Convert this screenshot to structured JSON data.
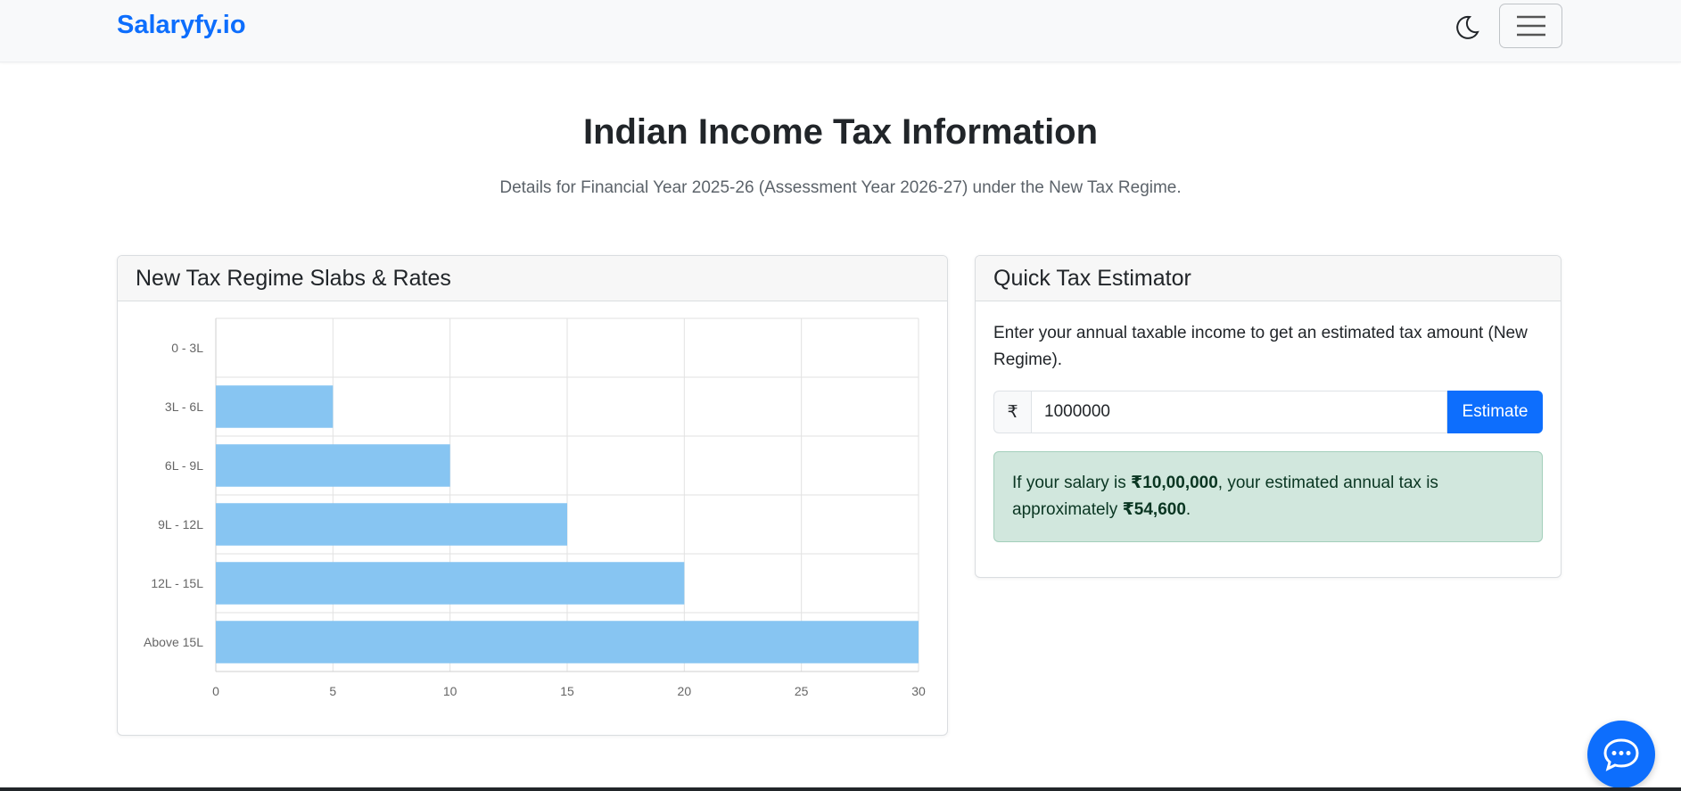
{
  "navbar": {
    "brand": "Salaryfy.io",
    "theme_icon": "moon-icon",
    "menu_icon": "hamburger-menu-icon"
  },
  "page": {
    "title": "Indian Income Tax Information",
    "subtitle": "Details for Financial Year 2025-26 (Assessment Year 2026-27) under the New Tax Regime."
  },
  "slabs_card": {
    "title": "New Tax Regime Slabs & Rates"
  },
  "estimator": {
    "title": "Quick Tax Estimator",
    "description": "Enter your annual taxable income to get an estimated tax amount (New Regime).",
    "currency_symbol": "₹",
    "income_value": "1000000",
    "button_label": "Estimate",
    "result_prefix": "If your salary is ",
    "result_salary": "₹10,00,000",
    "result_middle": ", your estimated annual tax is approximately ",
    "result_tax": "₹54,600",
    "result_suffix": "."
  },
  "chat": {
    "icon": "chat-bubble-icon"
  },
  "colors": {
    "brand": "#0d6efd",
    "bar": "#87c5f2",
    "alert_bg": "#d1e7dd"
  },
  "chart_data": {
    "type": "bar",
    "orientation": "horizontal",
    "categories": [
      "0 - 3L",
      "3L - 6L",
      "6L - 9L",
      "9L - 12L",
      "12L - 15L",
      "Above 15L"
    ],
    "values": [
      0,
      5,
      10,
      15,
      20,
      30
    ],
    "xlim": [
      0,
      30
    ],
    "xticks": [
      0,
      5,
      10,
      15,
      20,
      25,
      30
    ],
    "grid": true,
    "legend": "none"
  }
}
